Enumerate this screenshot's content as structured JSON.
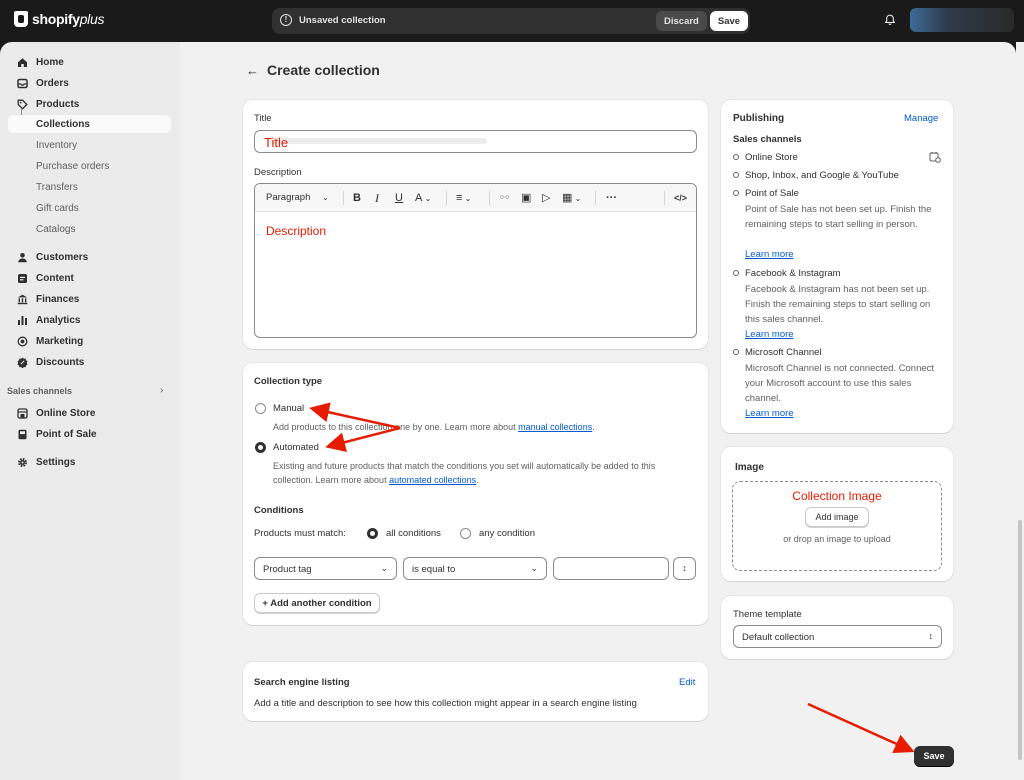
{
  "topbar": {
    "logo_word": "shopify",
    "logo_suffix": "plus",
    "unsaved_label": "Unsaved collection",
    "discard_label": "Discard",
    "save_label": "Save"
  },
  "sidebar": {
    "home": "Home",
    "orders": "Orders",
    "products": "Products",
    "collections": "Collections",
    "inventory": "Inventory",
    "purchase_orders": "Purchase orders",
    "transfers": "Transfers",
    "gift_cards": "Gift cards",
    "catalogs": "Catalogs",
    "customers": "Customers",
    "content": "Content",
    "finances": "Finances",
    "analytics": "Analytics",
    "marketing": "Marketing",
    "discounts": "Discounts",
    "sales_channels_label": "Sales channels",
    "online_store": "Online Store",
    "point_of_sale": "Point of Sale",
    "settings": "Settings"
  },
  "page": {
    "title": "Create collection"
  },
  "details": {
    "title_label": "Title",
    "title_overlay": "Title",
    "description_label": "Description",
    "paragraph_select": "Paragraph",
    "description_overlay": "Description"
  },
  "collection_type": {
    "heading": "Collection type",
    "manual_label": "Manual",
    "manual_help": "Add products to this collection one by one. Learn more about ",
    "manual_link": "manual collections",
    "automated_label": "Automated",
    "automated_help_1": "Existing and future products that match the conditions you set will automatically be added to this",
    "automated_help_2": "collection. Learn more about ",
    "automated_link": "automated collections",
    "conditions_heading": "Conditions",
    "must_match_label": "Products must match:",
    "all_conditions": "all conditions",
    "any_condition": "any condition",
    "condition_field": "Product tag",
    "condition_operator": "is equal to",
    "condition_value": "",
    "add_condition": "Add another condition"
  },
  "seo": {
    "heading": "Search engine listing",
    "edit": "Edit",
    "help": "Add a title and description to see how this collection might appear in a search engine listing"
  },
  "publishing": {
    "heading": "Publishing",
    "manage": "Manage",
    "channels_label": "Sales channels",
    "online_store": "Online Store",
    "shop": "Shop, Inbox, and Google & YouTube",
    "pos": "Point of Sale",
    "pos_desc": "Point of Sale has not been set up. Finish the remaining steps to start selling in person.",
    "fb": "Facebook & Instagram",
    "fb_desc": "Facebook & Instagram has not been set up. Finish the remaining steps to start selling on this sales channel.",
    "ms": "Microsoft Channel",
    "ms_desc": "Microsoft Channel is not connected. Connect your Microsoft account to use this sales channel.",
    "learn_more": "Learn more"
  },
  "image": {
    "heading": "Image",
    "overlay": "Collection Image",
    "add_image": "Add image",
    "drop_hint": "or drop an image to upload"
  },
  "theme": {
    "label": "Theme template",
    "value": "Default collection"
  },
  "footer": {
    "save": "Save"
  },
  "colors": {
    "annotation_red": "#e51c00",
    "link_blue": "#005bd3",
    "primary_dark": "#303030"
  }
}
